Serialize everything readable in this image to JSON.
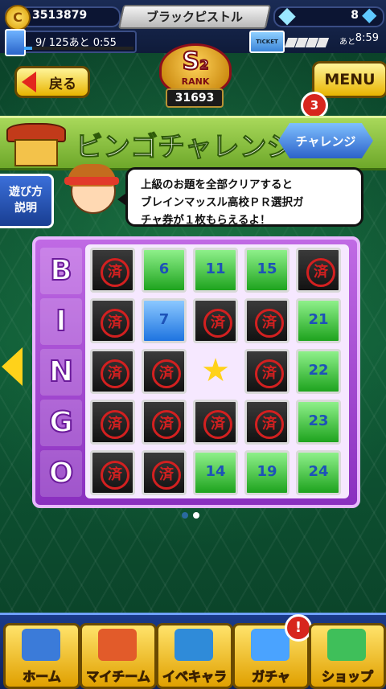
{
  "header": {
    "coins": "3513879",
    "player_name": "ブラックピストル",
    "gems": "8",
    "stamina_text": "9/ 125あと  0:55",
    "stamina_fill": 0.072,
    "ticket_label": "TICKET",
    "ticket_prefix": "あと",
    "ticket_timer": "8:59",
    "coin_glyph": "C"
  },
  "rank": {
    "letter": "S",
    "tier": "2",
    "label": "RANK",
    "points": "31693"
  },
  "nav_top": {
    "back_label": "戻る",
    "menu_label": "MENU",
    "notification_count": "3"
  },
  "title": {
    "text": "ビンゴチャレンジ",
    "challenge_button": "チャレンジ"
  },
  "howto": {
    "line1": "遊び方",
    "line2": "説明"
  },
  "bubble": {
    "line1": "上級のお題を全部クリアすると",
    "line2": "ブレインマッスル高校ＰＲ選択ガ",
    "line3": "チャ券が１枚もらえるよ！"
  },
  "bingo": {
    "letters": [
      "B",
      "I",
      "N",
      "G",
      "O"
    ],
    "done_label": "済",
    "cells": [
      {
        "state": "done",
        "label": "済"
      },
      {
        "state": "open",
        "label": "6"
      },
      {
        "state": "open",
        "label": "11"
      },
      {
        "state": "open",
        "label": "15"
      },
      {
        "state": "done",
        "label": "済"
      },
      {
        "state": "done",
        "label": "済"
      },
      {
        "state": "active",
        "label": "7"
      },
      {
        "state": "done",
        "label": "済"
      },
      {
        "state": "done",
        "label": "済"
      },
      {
        "state": "open",
        "label": "21"
      },
      {
        "state": "done",
        "label": "済"
      },
      {
        "state": "done",
        "label": "済"
      },
      {
        "state": "free",
        "label": ""
      },
      {
        "state": "done",
        "label": "済"
      },
      {
        "state": "open",
        "label": "22"
      },
      {
        "state": "done",
        "label": "済"
      },
      {
        "state": "done",
        "label": "済"
      },
      {
        "state": "done",
        "label": "済"
      },
      {
        "state": "done",
        "label": "済"
      },
      {
        "state": "open",
        "label": "23"
      },
      {
        "state": "done",
        "label": "済"
      },
      {
        "state": "done",
        "label": "済"
      },
      {
        "state": "open",
        "label": "14"
      },
      {
        "state": "open",
        "label": "19"
      },
      {
        "state": "open",
        "label": "24"
      }
    ]
  },
  "bottom_nav": [
    {
      "label": "ホーム",
      "icon": "home-book-icon"
    },
    {
      "label": "マイチーム",
      "icon": "team-icon"
    },
    {
      "label": "イベキャラ",
      "icon": "event-character-icon"
    },
    {
      "label": "ガチャ",
      "icon": "gacha-icon",
      "alert": "!"
    },
    {
      "label": "ショップ",
      "icon": "shop-icon"
    }
  ],
  "colors": {
    "accent_gold": "#ffd21a",
    "alert_red": "#d7261d",
    "board_purple": "#8a2fbf",
    "cell_green": "#1ea31e",
    "cell_blue": "#1e74e0"
  }
}
